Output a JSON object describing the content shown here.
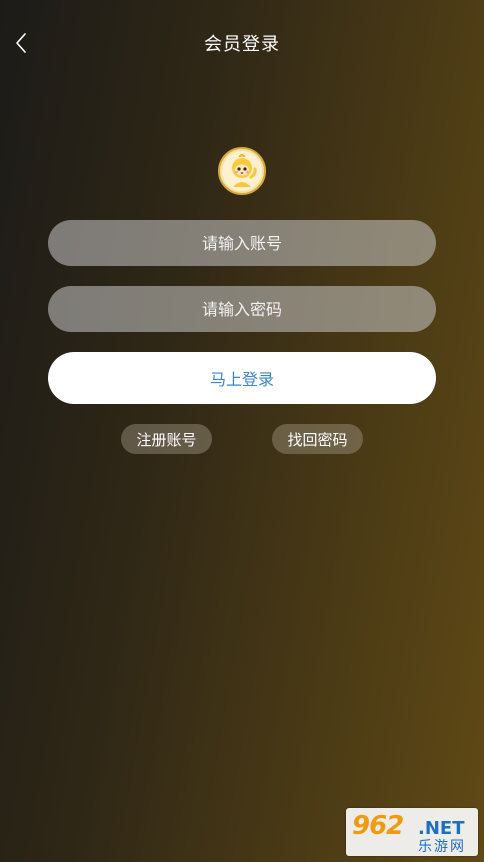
{
  "header": {
    "title": "会员登录",
    "back_icon": "chevron-left-icon"
  },
  "avatar": {
    "icon": "mascot-avatar-icon"
  },
  "form": {
    "account_placeholder": "请输入账号",
    "password_placeholder": "请输入密码",
    "login_label": "马上登录",
    "register_label": "注册账号",
    "forgot_label": "找回密码"
  },
  "watermark": {
    "number": "962",
    "domain": ".NET",
    "name": "乐游网"
  },
  "colors": {
    "login_text": "#3a86c8",
    "gradient_start": "#1c1b18",
    "gradient_end": "#604915"
  }
}
